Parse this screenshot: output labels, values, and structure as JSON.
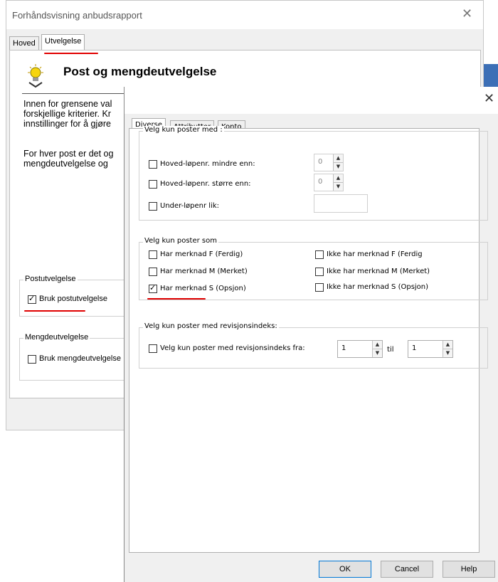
{
  "back": {
    "title": "Forhåndsvisning anbudsrapport",
    "close": "✕",
    "tabs": [
      "Hoved",
      "Utvelgelse"
    ],
    "heading": "Post og mengdeutvelgelse",
    "para1": [
      "Innen for grensene val",
      "forskjellige kriterier. Kr",
      "innstillinger for å gjøre"
    ],
    "para2": [
      "For hver post er det og",
      "mengdeutvelgelse og"
    ],
    "group1": {
      "title": "Postutvelgelse",
      "checkbox": "Bruk postutvelgelse",
      "checked": true
    },
    "group2": {
      "title": "Mengdeutvelgelse",
      "checkbox": "Bruk mengdeutvelgelse",
      "checked": false
    }
  },
  "front": {
    "close": "✕",
    "tabs": [
      "Diverse",
      "Attributter",
      "Konto"
    ],
    "group1": {
      "title": "Velg kun poster med :",
      "rows": [
        {
          "label": "Hoved-løpenr. mindre enn:",
          "value": "0"
        },
        {
          "label": "Hoved-løpenr. større enn:",
          "value": "0"
        },
        {
          "label": "Under-løpenr lik:",
          "value": ""
        }
      ]
    },
    "group2": {
      "title": "Velg kun poster som",
      "left": [
        {
          "label": "Har merknad F (Ferdig)",
          "checked": false
        },
        {
          "label": "Har merknad M (Merket)",
          "checked": false
        },
        {
          "label": "Har merknad S (Opsjon)",
          "checked": true
        }
      ],
      "right": [
        {
          "label": "Ikke har merknad F (Ferdig",
          "checked": false
        },
        {
          "label": "Ikke har merknad M (Merket)",
          "checked": false
        },
        {
          "label": "Ikke har merknad S (Opsjon)",
          "checked": false
        }
      ]
    },
    "group3": {
      "title": "Velg kun poster med revisjonsindeks:",
      "checkbox": "Velg kun poster med revisjonsindeks fra:",
      "from": "1",
      "til": "til",
      "to": "1"
    },
    "buttons": {
      "ok": "OK",
      "cancel": "Cancel",
      "help": "Help"
    }
  },
  "colors": {
    "annotation_red": "#e00000",
    "window_bg": "#f0f0f0",
    "accent_blue": "#3c6fb6"
  }
}
